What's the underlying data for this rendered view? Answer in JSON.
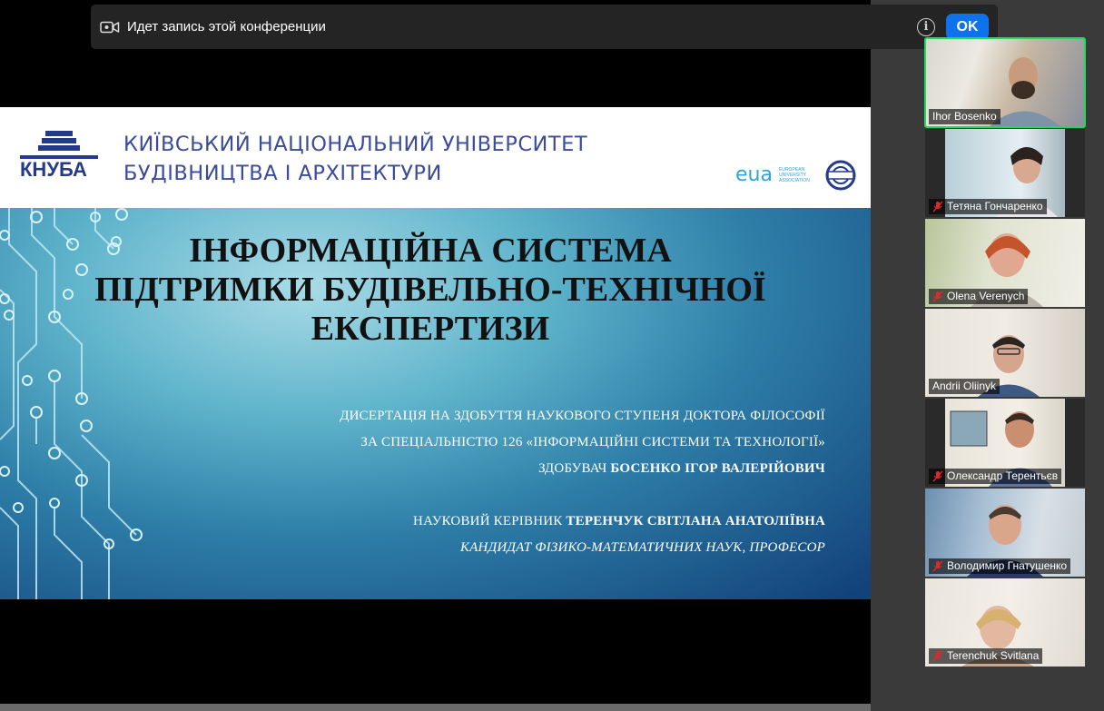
{
  "recording_banner": {
    "message": "Идет запись этой конференции",
    "info_glyph": "i",
    "ok_label": "OK",
    "ok_color": "#0e72ed"
  },
  "slide": {
    "logo_text": "КНУБА",
    "university_name": [
      "КИЇВСЬКИЙ НАЦІОНАЛЬНИЙ УНІВЕРСИТЕТ",
      "БУДІВНИЦТВА І АРХІТЕКТУРИ"
    ],
    "eua_text": "eua",
    "eua_subtext": [
      "EUROPEAN",
      "UNIVERSITY",
      "ASSOCIATION"
    ],
    "title": [
      "ІНФОРМАЦІЙНА СИСТЕМА",
      "ПІДТРИМКИ БУДІВЕЛЬНО-ТЕХНІЧНОЇ",
      "ЕКСПЕРТИЗИ"
    ],
    "line1": "ДИСЕРТАЦІЯ НА ЗДОБУТТЯ НАУКОВОГО СТУПЕНЯ ДОКТОРА ФІЛОСОФІЇ",
    "line2": "ЗА СПЕЦІАЛЬНІСТЮ 126 «ІНФОРМАЦІЙНІ СИСТЕМИ ТА ТЕХНОЛОГІЇ»",
    "line3_prefix": "ЗДОБУВАЧ ",
    "line3_name": "БОСЕНКО ІГОР ВАЛЕРІЙОВИЧ",
    "line4_prefix": "НАУКОВИЙ КЕРІВНИК ",
    "line4_name": "ТЕРЕНЧУК СВІТЛАНА АНАТОЛІЇВНА",
    "line5": "КАНДИДАТ ФІЗИКО-МАТЕМАТИЧНИХ НАУК, ПРОФЕСОР"
  },
  "participants": [
    {
      "name": "Ihor Bosenko",
      "muted": false,
      "active_speaker": true
    },
    {
      "name": "Тетяна Гончаренко",
      "muted": true,
      "active_speaker": false
    },
    {
      "name": "Olena Verenych",
      "muted": true,
      "active_speaker": false
    },
    {
      "name": "Andrii Oliinyk",
      "muted": false,
      "active_speaker": false
    },
    {
      "name": "Олександр Терентьєв",
      "muted": true,
      "active_speaker": false
    },
    {
      "name": "Володимир Гнатушенко",
      "muted": true,
      "active_speaker": false
    },
    {
      "name": "Terenchuk Svitlana",
      "muted": true,
      "active_speaker": false
    }
  ],
  "colors": {
    "active_speaker_border": "#23d959",
    "muted_icon": "#e02828"
  }
}
